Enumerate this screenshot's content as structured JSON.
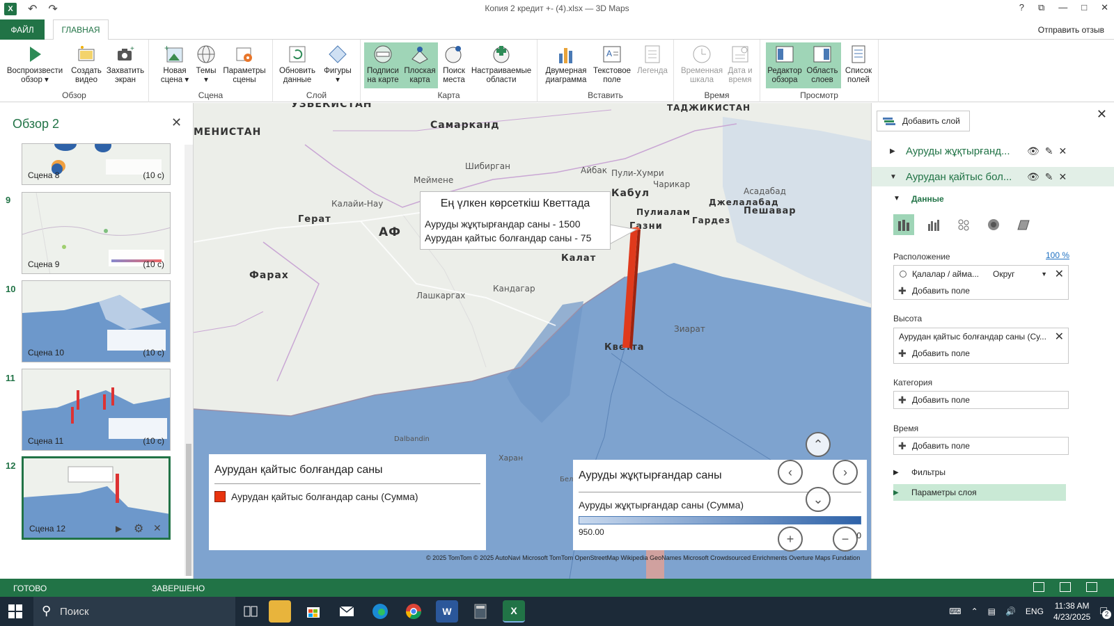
{
  "window": {
    "title": "Копия 2 кредит +- (4).xlsx — 3D Maps",
    "help": "?",
    "restore_label": "⧉",
    "minimize": "—",
    "maximize": "□",
    "close": "✕"
  },
  "tabs": {
    "file": "ФАЙЛ",
    "home": "ГЛАВНАЯ",
    "feedback": "Отправить отзыв"
  },
  "ribbon": {
    "groups": {
      "tour": "Обзор",
      "scene": "Сцена",
      "layer": "Слой",
      "map": "Карта",
      "insert": "Вставить",
      "time": "Время",
      "view": "Просмотр"
    },
    "buttons": {
      "play_tour": [
        "Воспроизвести",
        "обзор ▾"
      ],
      "create_video": [
        "Создать",
        "видео"
      ],
      "capture_screen": [
        "Захватить",
        "экран"
      ],
      "new_scene": [
        "Новая",
        "сцена ▾"
      ],
      "themes": [
        "Темы",
        "▾"
      ],
      "scene_options": [
        "Параметры",
        "сцены"
      ],
      "refresh_data": [
        "Обновить",
        "данные"
      ],
      "shapes": [
        "Фигуры",
        "▾"
      ],
      "map_labels": [
        "Подписи",
        "на карте"
      ],
      "flat_map": [
        "Плоская",
        "карта"
      ],
      "find_location": [
        "Поиск",
        "места"
      ],
      "custom_regions": [
        "Настраиваемые",
        "области"
      ],
      "2d_chart": [
        "Двумерная",
        "диаграмма"
      ],
      "text_box": [
        "Текстовое",
        "поле"
      ],
      "legend": [
        "Легенда",
        ""
      ],
      "timeline": [
        "Временная",
        "шкала"
      ],
      "date_time": [
        "Дата и",
        "время"
      ],
      "tour_editor": [
        "Редактор",
        "обзора"
      ],
      "layer_pane": [
        "Область",
        "слоев"
      ],
      "field_list": [
        "Список",
        "полей"
      ]
    }
  },
  "tour": {
    "title": "Обзор 2",
    "close": "✕",
    "scenes": [
      {
        "num": "",
        "name": "Сцена 8",
        "duration": "(10 с)"
      },
      {
        "num": "9",
        "name": "Сцена 9",
        "duration": "(10 с)"
      },
      {
        "num": "10",
        "name": "Сцена 10",
        "duration": "(10 с)"
      },
      {
        "num": "11",
        "name": "Сцена 11",
        "duration": "(10 с)"
      },
      {
        "num": "12",
        "name": "Сцена 12",
        "duration": ""
      }
    ]
  },
  "map": {
    "labels": {
      "uzbekistan": "УЗБЕКИСТАН",
      "turkmenistan": "МЕНИСТАН",
      "samarkand": "Самарканд",
      "tajikistan": "ТАДЖИКИСТАН",
      "shibirgan": "Шибирган",
      "maymene": "Меймене",
      "aybak": "Айбак",
      "puli_khumri": "Пули-Хумри",
      "charikar": "Чарикар",
      "kabul": "Кабул",
      "asadabad": "Асадабад",
      "jalalabad": "Джелалабад",
      "peshawar": "Пешавар",
      "herat": "Герат",
      "kalai_nau": "Калайи-Нау",
      "pulialam": "Пулиалам",
      "gardez": "Гардез",
      "ghazni": "Газни",
      "afg": "АФ",
      "farah": "Фарах",
      "kalat": "Калат",
      "kandahar": "Кандагар",
      "lashkargah": "Лашкаргах",
      "ziarat": "Зиарат",
      "quetta": "Кветта",
      "dalbandin": "Dalbandin",
      "kharan": "Харан",
      "bel": "Бел"
    },
    "tooltip": {
      "title": "Ең үлкен көрсеткіш Кветтада",
      "line1": "Ауруды жұқтырғандар саны - 1500",
      "line2": "Аурудан қайтыс болғандар саны - 75"
    },
    "legend_deaths": {
      "title": "Аурудан қайтыс болғандар саны",
      "item": "Аурудан қайтыс болғандар саны (Сумма)",
      "color": "#e8340f"
    },
    "legend_infected": {
      "title": "Ауруды жұқтырғандар саны",
      "subtitle": "Ауруды жұқтырғандар саны (Сумма)",
      "min": "950.00",
      "max": "0"
    },
    "attribution": "© 2025 TomTom  © 2025 AutoNavi  Microsoft  TomTom  OpenStreetMap  Wikipedia  GeoNames  Microsoft Crowdsourced Enrichments  Overture Maps Fundation"
  },
  "layers": {
    "add_layer": "Добавить слой",
    "close": "✕",
    "layer1_name": "Ауруды жұқтырғанд...",
    "layer2_name": "Аурудан қайтыс бол...",
    "data_section": "Данные",
    "location_label": "Расположение",
    "location_pct": "100 %",
    "location_field": "Қалалар / айма...",
    "location_type": "Округ",
    "add_field": "Добавить поле",
    "height_label": "Высота",
    "height_field": "Аурудан қайтыс болғандар саны (Су...",
    "category_label": "Категория",
    "time_label": "Время",
    "filters": "Фильтры",
    "layer_options": "Параметры слоя"
  },
  "status": {
    "ready": "ГОТОВО",
    "done": "ЗАВЕРШЕНО"
  },
  "taskbar": {
    "search": "Поиск",
    "lang": "ENG",
    "time": "11:38 AM",
    "date": "4/23/2025",
    "notifications": "2"
  }
}
